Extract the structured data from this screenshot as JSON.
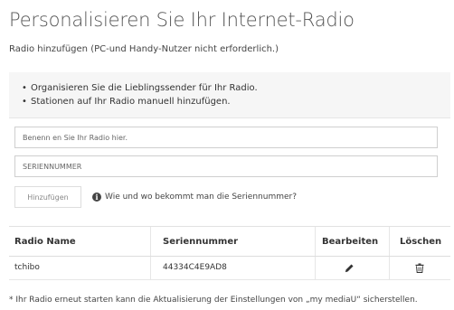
{
  "page": {
    "title": "Personalisieren Sie Ihr Internet-Radio",
    "subtitle": "Radio hinzufügen (PC-und Handy-Nutzer nicht erforderlich.)"
  },
  "info_list": [
    "Organisieren Sie die Lieblingssender für Ihr Radio.",
    "Stationen auf Ihr Radio manuell hinzufügen."
  ],
  "form": {
    "name_placeholder": "Benenn en Sie Ihr Radio hier.",
    "serial_placeholder": "SERIENNUMMER",
    "add_label": "Hinzufügen",
    "help_text": "Wie und wo bekommt man die Seriennummer?"
  },
  "table": {
    "headers": {
      "name": "Radio Name",
      "serial": "Seriennummer",
      "edit": "Bearbeiten",
      "delete": "Löschen"
    },
    "rows": [
      {
        "name": "tchibo",
        "serial": "44334C4E9AD8"
      }
    ]
  },
  "footnote": "* Ihr Radio erneut starten kann die Aktualisierung der Einstellungen von „my mediaU“ sicherstellen.",
  "icons": {
    "info": "info-circle-icon",
    "edit": "pencil-icon",
    "delete": "trash-icon"
  }
}
